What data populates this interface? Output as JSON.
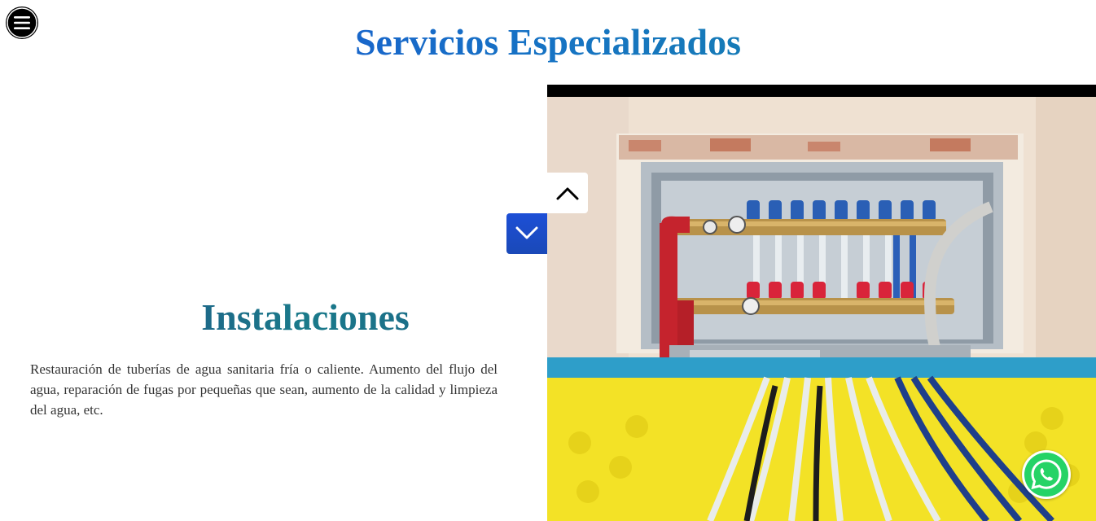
{
  "header": {
    "title": "Servicios Especializados",
    "menu_icon": "hamburger-menu-icon"
  },
  "section": {
    "heading": "Instalaciones",
    "description": "Restauración de tuberías de agua sanitaria fría o caliente. Aumento del flujo del agua, reparación de fugas por pequeñas que sean, aumento de la calidad y limpieza del agua, etc."
  },
  "navigation": {
    "up_icon": "chevron-up-icon",
    "down_icon": "chevron-down-icon"
  },
  "floating": {
    "whatsapp_icon": "whatsapp-icon"
  },
  "colors": {
    "title_gradient_start": "#1d4fd6",
    "title_gradient_end": "#14889f",
    "heading_gradient_start": "#244a86",
    "heading_gradient_end": "#1a7a8a",
    "nav_down_bg": "#1d4fd6",
    "whatsapp_green": "#25d366"
  }
}
